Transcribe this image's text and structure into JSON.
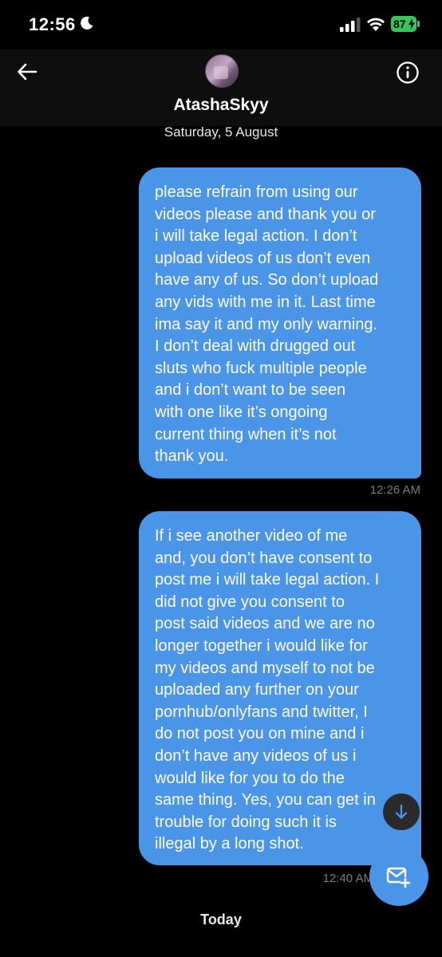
{
  "status_bar": {
    "time": "12:56",
    "battery": "87",
    "icons": [
      "moon-icon",
      "signal-icon",
      "wifi-icon",
      "battery-icon"
    ],
    "battery_color": "#34c759"
  },
  "header": {
    "contact_name": "AtashaSkyy",
    "icons": [
      "back-arrow-icon",
      "info-icon"
    ]
  },
  "conversation": {
    "date_separator": "Saturday, 5 August",
    "messages": [
      {
        "text": "please refrain from using our\nvideos please and thank you or\ni will take legal action. I don’t\nupload videos of us don’t even\nhave any of us. So don’t upload\nany vids with me in it. Last time\nima say it and my only warning.\nI don’t deal with drugged out\nsluts who fuck multiple people\nand i don’t want to be seen\nwith one like it’s ongoing\ncurrent thing when it’s not\nthank you.",
        "time": "12:26 AM"
      },
      {
        "text": "If i see another video of me\nand, you don’t have consent to\npost me i will take legal action. I\ndid not give you consent to\npost said videos and we are no\nlonger together i would like for\nmy videos and myself to not be\nuploaded any further on your\npornhub/onlyfans and twitter, I\ndo not post you on mine and i\ndon’t have any videos of us i\nwould like for you to do the\nsame thing. Yes, you can get in\ntrouble for doing such it is\nillegal by a long shot.",
        "time": "12:40 AM"
      }
    ],
    "today_separator": "Today"
  },
  "colors": {
    "bubble": "#4a95e8",
    "background": "#000000",
    "timestamp": "#7b7b7b"
  },
  "floating_buttons": [
    "scroll-down-icon",
    "new-message-icon"
  ]
}
